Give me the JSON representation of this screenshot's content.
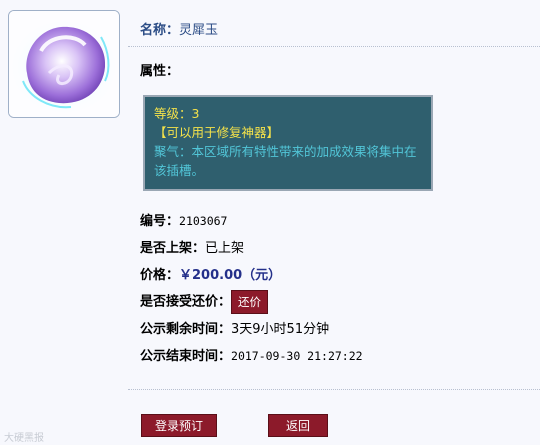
{
  "item": {
    "name_label": "名称：",
    "name": "灵犀玉",
    "attr_label": "属性：",
    "level": "等级：3",
    "repair": "【可以用于修复神器】",
    "desc": "聚气：本区域所有特性带来的加成效果将集中在该插槽。",
    "id_label": "编号：",
    "id": "2103067",
    "listed_label": "是否上架：",
    "listed": "已上架",
    "price_label": "价格：",
    "price": "￥200.00（元）",
    "bargain_label": "是否接受还价：",
    "bargain_btn": "还价",
    "remain_label": "公示剩余时间：",
    "remain": "3天9小时51分钟",
    "end_label": "公示结束时间：",
    "end": "2017-09-30 21:27:22"
  },
  "actions": {
    "login": "登录预订",
    "back": "返回"
  },
  "watermark": "大硬黑报"
}
